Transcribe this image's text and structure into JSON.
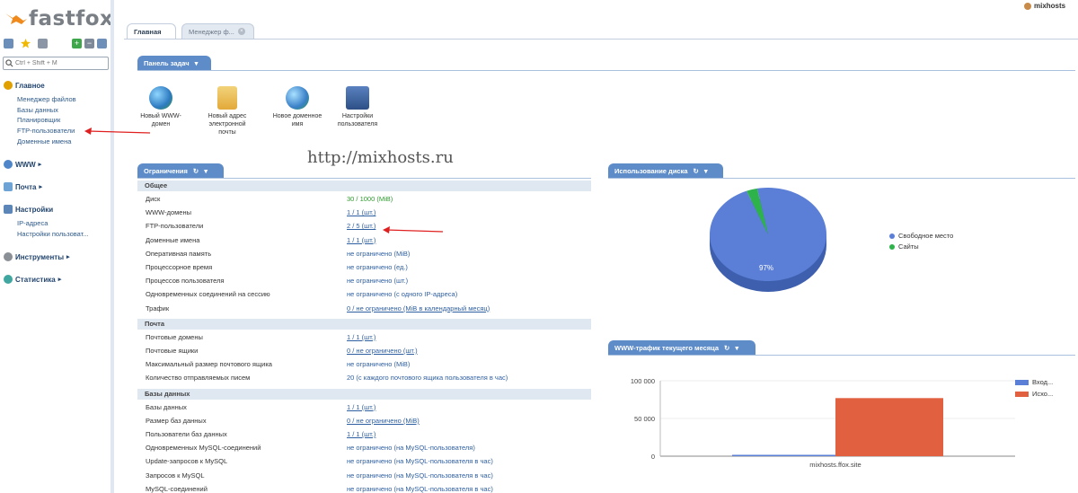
{
  "app": {
    "logo": "fastfox",
    "user": "mixhosts"
  },
  "search": {
    "placeholder": "Ctrl + Shift + M"
  },
  "sidebar": {
    "sections": [
      {
        "title": "Главное",
        "items": [
          "Менеджер файлов",
          "Базы данных",
          "Планировщик",
          "FTP-пользователи",
          "Доменные имена"
        ]
      },
      {
        "title": "WWW",
        "items": []
      },
      {
        "title": "Почта",
        "items": []
      },
      {
        "title": "Настройки",
        "items": [
          "IP-адреса",
          "Настройки пользоват..."
        ]
      },
      {
        "title": "Инструменты",
        "items": []
      },
      {
        "title": "Статистика",
        "items": []
      }
    ]
  },
  "tabs": [
    {
      "label": "Главная",
      "active": true
    },
    {
      "label": "Менеджер ф...",
      "active": false
    }
  ],
  "taskpanel": {
    "title": "Панель задач",
    "items": [
      {
        "label": "Новый WWW-домен",
        "icon": "globe-icon"
      },
      {
        "label": "Новый адрес электронной почты",
        "icon": "mail-icon"
      },
      {
        "label": "Новое доменное имя",
        "icon": "globe-domain-icon"
      },
      {
        "label": "Настройки пользователя",
        "icon": "settings-icon"
      }
    ]
  },
  "watermark": "http://mixhosts.ru",
  "limits": {
    "title": "Ограничения",
    "sections": [
      {
        "name": "Общее",
        "rows": [
          {
            "label": "Диск",
            "value": "30 / 1000 (MiB)"
          },
          {
            "label": "WWW-домены",
            "value": "1 / 1 (шт.)"
          },
          {
            "label": "FTP-пользователи",
            "value": "2 / 5 (шт.)"
          },
          {
            "label": "Доменные имена",
            "value": "1 / 1 (шт.)"
          },
          {
            "label": "Оперативная память",
            "value": "не ограничено (MiB)"
          },
          {
            "label": "Процессорное время",
            "value": "не ограничено (ед.)"
          },
          {
            "label": "Процессов пользователя",
            "value": "не ограничено (шт.)"
          },
          {
            "label": "Одновременных соединений на сессию",
            "value": "не ограничено (с одного IP-адреса)"
          },
          {
            "label": "Трафик",
            "value": "0 / не ограничено (MiB в календарный месяц)"
          }
        ]
      },
      {
        "name": "Почта",
        "rows": [
          {
            "label": "Почтовые домены",
            "value": "1 / 1 (шт.)"
          },
          {
            "label": "Почтовые ящики",
            "value": "0 / не ограничено (шт.)"
          },
          {
            "label": "Максимальный размер почтового ящика",
            "value": "не ограничено (MiB)"
          },
          {
            "label": "Количество отправляемых писем",
            "value": "20 (с каждого почтового ящика пользователя в час)"
          }
        ]
      },
      {
        "name": "Базы данных",
        "rows": [
          {
            "label": "Базы данных",
            "value": "1 / 1 (шт.)"
          },
          {
            "label": "Размер баз данных",
            "value": "0 / не ограничено (MiB)"
          },
          {
            "label": "Пользователи баз данных",
            "value": "1 / 1 (шт.)"
          },
          {
            "label": "Одновременных MySQL-соединений",
            "value": "не ограничено (на MySQL-пользователя)"
          },
          {
            "label": "Update-запросов к MySQL",
            "value": "не ограничено (на MySQL-пользователя в час)"
          },
          {
            "label": "Запросов к MySQL",
            "value": "не ограничено (на MySQL-пользователя в час)"
          },
          {
            "label": "MySQL-соединений",
            "value": "не ограничено (на MySQL-пользователя в час)"
          }
        ]
      }
    ]
  },
  "disk": {
    "title": "Использование диска",
    "legend": [
      "Свободное место",
      "Сайты"
    ],
    "colors": [
      "#5b7fd6",
      "#2db34a"
    ]
  },
  "traffic": {
    "title": "WWW-трафик текущего месяца",
    "legend": [
      "Вход...",
      "Исхо..."
    ],
    "colors": [
      "#5b7fd6",
      "#e06040"
    ]
  },
  "chart_data": [
    {
      "type": "pie",
      "title": "Использование диска",
      "categories": [
        "Свободное место",
        "Сайты"
      ],
      "values": [
        97,
        3
      ],
      "labels": [
        "97%"
      ],
      "legend": "right"
    },
    {
      "type": "bar",
      "title": "WWW-трафик текущего месяца",
      "categories": [
        "mixhosts.ffox.site"
      ],
      "series": [
        {
          "name": "Вход...",
          "values": [
            1800
          ]
        },
        {
          "name": "Исхо...",
          "values": [
            77000
          ]
        }
      ],
      "yticks": [
        "100 000",
        "50 000",
        "0"
      ],
      "ylim": [
        0,
        100000
      ],
      "legend": "top-right"
    }
  ]
}
